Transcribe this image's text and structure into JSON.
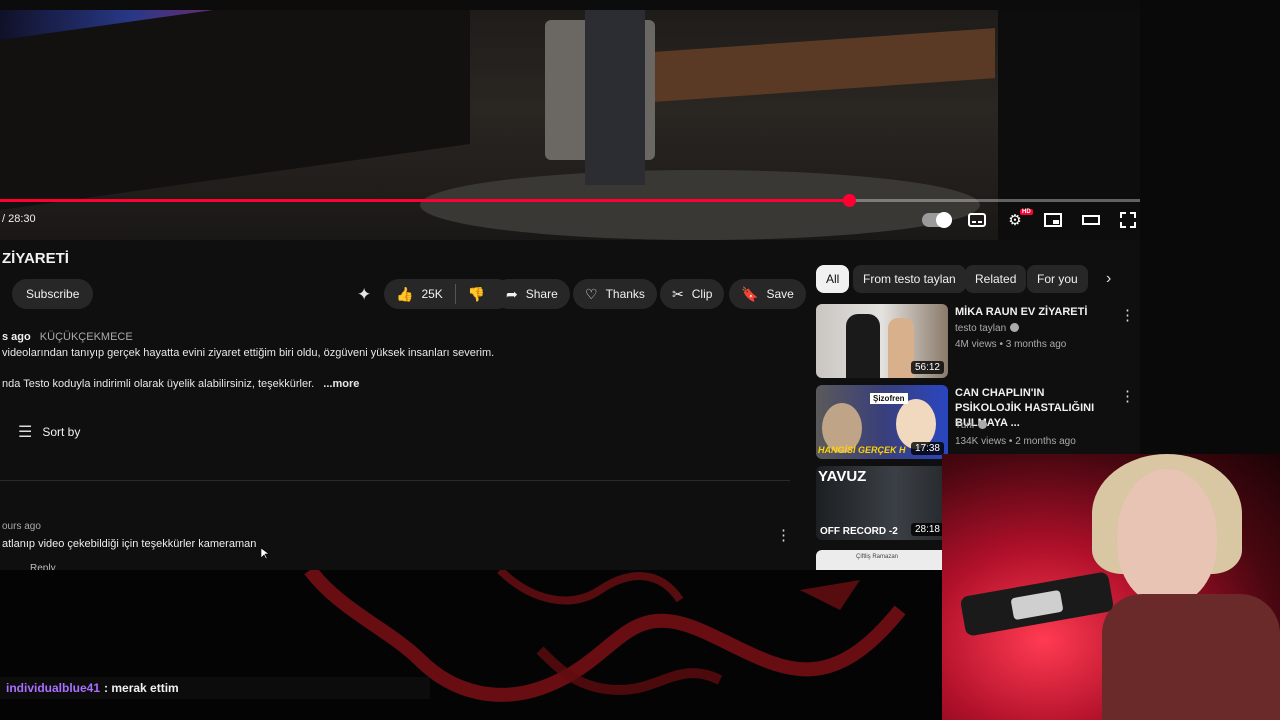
{
  "player": {
    "time_label": "/ 28:30",
    "progress": 0.745,
    "controls": [
      "autoplay-toggle",
      "subtitles",
      "settings",
      "miniplayer",
      "theater",
      "fullscreen"
    ]
  },
  "video": {
    "title": "ZİYARETİ",
    "subscribe_label": "Subscribe",
    "likes": "25K",
    "actions": {
      "share": "Share",
      "thanks": "Thanks",
      "clip": "Clip",
      "save": "Save"
    },
    "desc_meta_ago": "s ago",
    "desc_meta_tag": "KÜÇÜKÇEKMECE",
    "desc_line1": "videolarından tanıyıp gerçek hayatta evini ziyaret ettiğim biri oldu, özgüveni yüksek insanları severim.",
    "desc_line2": "nda Testo koduyla indirimli olarak üyelik alabilirsiniz, teşekkürler.",
    "more_label": "...more"
  },
  "comments": {
    "sort_label": "Sort by",
    "items": [
      {
        "time": "ours ago",
        "text": "atlanıp video çekebildiği için teşekkürler kameraman",
        "reply": "Reply"
      }
    ]
  },
  "chips": [
    "All",
    "From testo taylan",
    "Related",
    "For you"
  ],
  "recommendations": [
    {
      "title": "MİKA RAUN EV ZİYARETİ",
      "channel": "testo taylan",
      "meta": "4M views • 3 months ago",
      "duration": "56:12"
    },
    {
      "title": "CAN CHAPLIN'IN PSİKOLOJİK HASTALIĞINI BULMAYA ...",
      "channel": "Tuni",
      "meta": "134K views • 2 months ago",
      "duration": "17:38",
      "thumb_text": [
        "Şizofren",
        "HANGİSİ GERÇEK H"
      ]
    },
    {
      "title": "",
      "channel": "",
      "meta": "",
      "duration": "28:18",
      "thumb_text": [
        "YAVUZ",
        "OFF RECORD -2"
      ]
    },
    {
      "title": "",
      "channel": "",
      "meta": "",
      "duration": "",
      "thumb_text": [
        "Çiftliş Ramazan"
      ]
    }
  ],
  "stream": {
    "chat_user": "individualblue41",
    "chat_message": ": merak ettim"
  },
  "colors": {
    "accent": "#ff0033",
    "chat_user": "#a970ff",
    "background": "#0f0f0f"
  }
}
